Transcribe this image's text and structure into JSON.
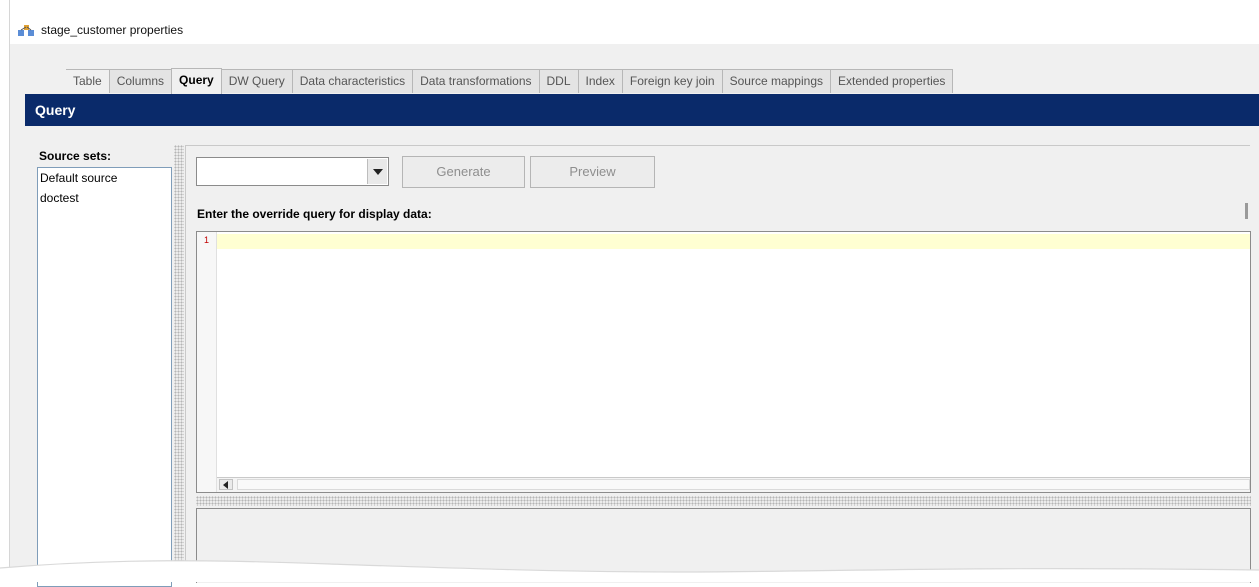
{
  "window": {
    "title": "stage_customer properties"
  },
  "tabs": [
    {
      "label": "Table"
    },
    {
      "label": "Columns"
    },
    {
      "label": "Query",
      "active": true
    },
    {
      "label": "DW Query"
    },
    {
      "label": "Data characteristics"
    },
    {
      "label": "Data transformations"
    },
    {
      "label": "DDL"
    },
    {
      "label": "Index"
    },
    {
      "label": "Foreign key join"
    },
    {
      "label": "Source mappings"
    },
    {
      "label": "Extended properties"
    }
  ],
  "header": {
    "title": "Query"
  },
  "source_sets": {
    "label": "Source sets:",
    "items": [
      "Default source",
      "doctest"
    ]
  },
  "toolbar": {
    "combo_value": "",
    "generate_label": "Generate",
    "preview_label": "Preview"
  },
  "editor": {
    "prompt": "Enter the override query for display data:",
    "line_number": "1",
    "content": ""
  },
  "colors": {
    "header_bg": "#0a2a6a",
    "current_line": "#ffffd2",
    "line_number": "#c00000"
  }
}
